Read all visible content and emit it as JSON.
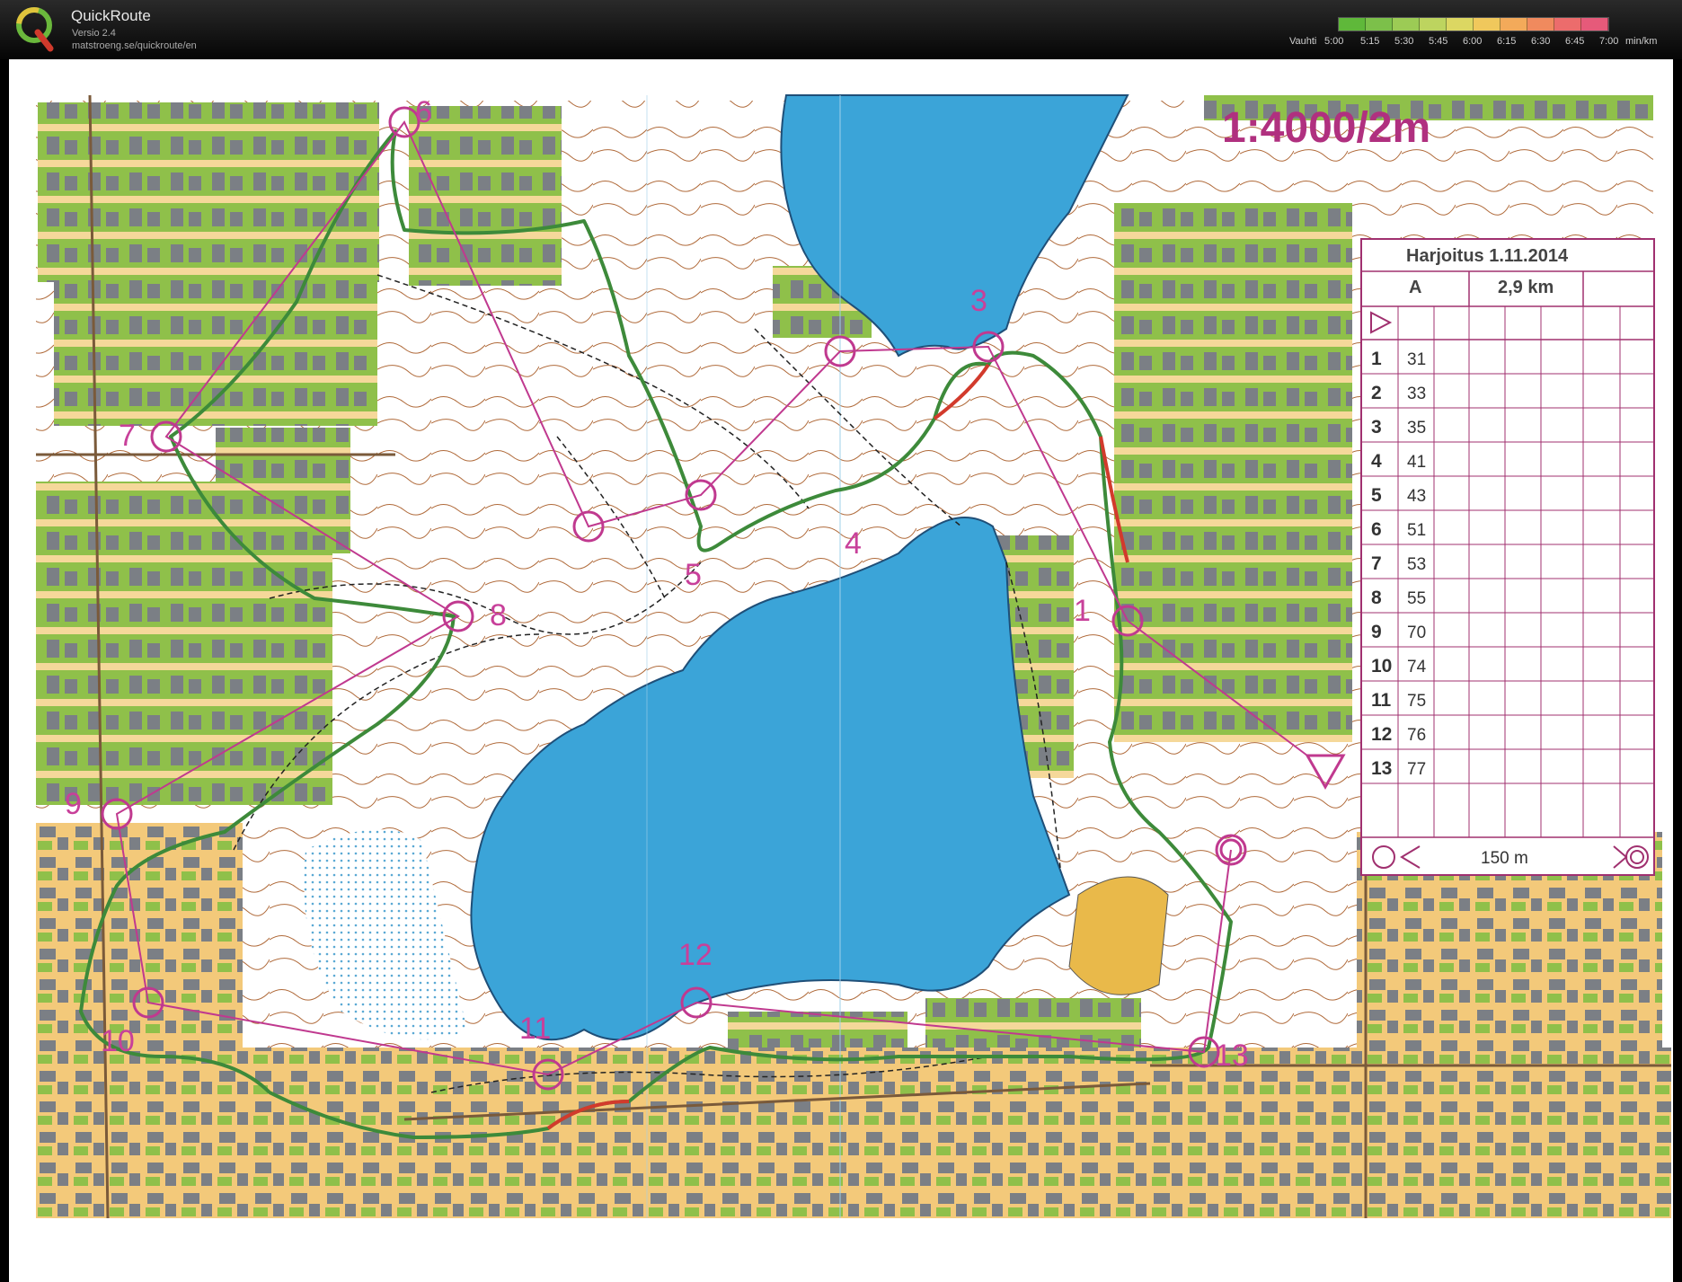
{
  "app": {
    "title": "QuickRoute",
    "version": "Versio 2.4",
    "url": "matstroeng.se/quickroute/en"
  },
  "pace_scale": {
    "label": "Vauhti",
    "ticks": [
      "5:00",
      "5:15",
      "5:30",
      "5:45",
      "6:00",
      "6:15",
      "6:30",
      "6:45",
      "7:00"
    ],
    "unit": "min/km",
    "colors": [
      "#5fb83a",
      "#7cc04a",
      "#9ccb55",
      "#bdd45f",
      "#dcd762",
      "#f0c85c",
      "#f3aa5a",
      "#f08a5e",
      "#ec6c6c",
      "#e65a7a"
    ]
  },
  "map": {
    "scale_label": "1:4000/2m",
    "controls": [
      {
        "label": "1"
      },
      {
        "label": "3"
      },
      {
        "label": "4"
      },
      {
        "label": "5"
      },
      {
        "label": "6"
      },
      {
        "label": "7"
      },
      {
        "label": "8"
      },
      {
        "label": "9"
      },
      {
        "label": "10"
      },
      {
        "label": "11"
      },
      {
        "label": "12"
      },
      {
        "label": "13"
      }
    ],
    "description_sheet": {
      "title": "Harjoitus 1.11.2014",
      "course": "A",
      "length": "2,9 km",
      "rows": [
        {
          "num": "1",
          "code": "31"
        },
        {
          "num": "2",
          "code": "33"
        },
        {
          "num": "3",
          "code": "35"
        },
        {
          "num": "4",
          "code": "41"
        },
        {
          "num": "5",
          "code": "43"
        },
        {
          "num": "6",
          "code": "51"
        },
        {
          "num": "7",
          "code": "53"
        },
        {
          "num": "8",
          "code": "55"
        },
        {
          "num": "9",
          "code": "70"
        },
        {
          "num": "10",
          "code": "74"
        },
        {
          "num": "11",
          "code": "75"
        },
        {
          "num": "12",
          "code": "76"
        },
        {
          "num": "13",
          "code": "77"
        }
      ],
      "finish_text": "150 m"
    },
    "colors": {
      "water": "#3ba4d8",
      "forest": "#8fc04a",
      "open": "#f0c050",
      "course": "#c0398f",
      "route": "#3d8a3a",
      "route_fast": "#d23a2c"
    }
  }
}
